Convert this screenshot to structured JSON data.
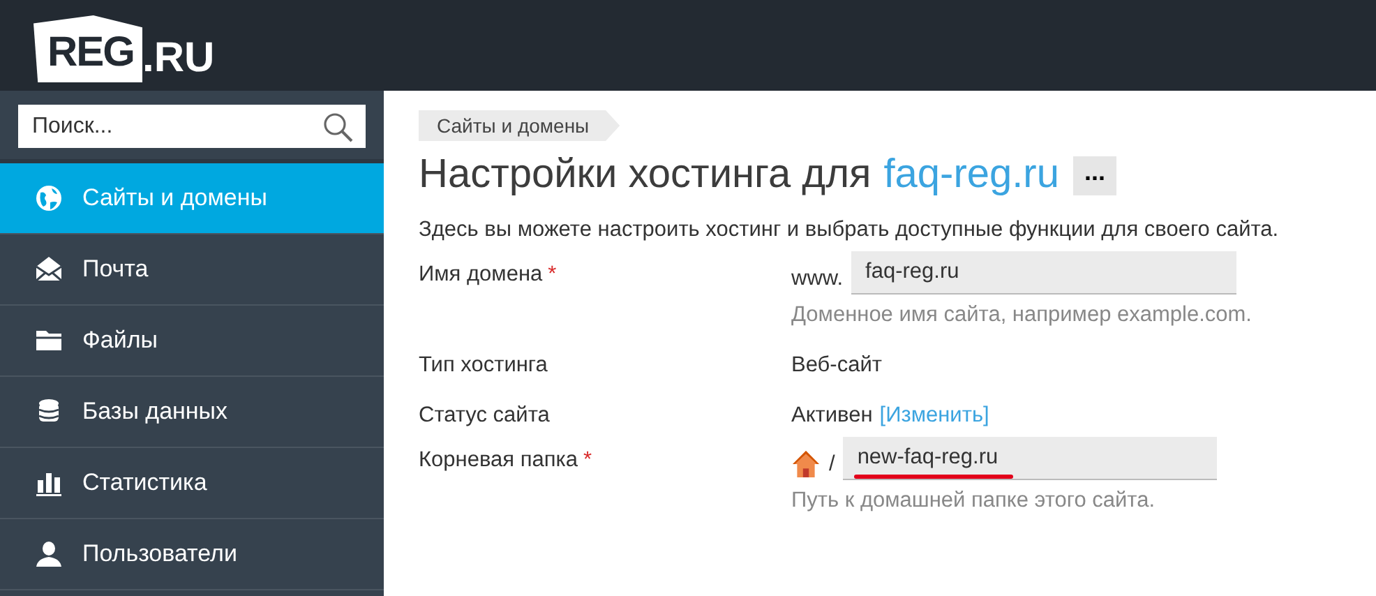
{
  "header": {
    "logo": {
      "mark": "REG",
      "suffix": ".RU"
    }
  },
  "sidebar": {
    "search": {
      "placeholder": "Поиск..."
    },
    "items": [
      {
        "label": "Сайты и домены",
        "selected": true
      },
      {
        "label": "Почта",
        "selected": false
      },
      {
        "label": "Файлы",
        "selected": false
      },
      {
        "label": "Базы данных",
        "selected": false
      },
      {
        "label": "Статистика",
        "selected": false
      },
      {
        "label": "Пользователи",
        "selected": false
      }
    ]
  },
  "breadcrumb": "Сайты и домены",
  "title": {
    "text": "Настройки хостинга для",
    "domain": "faq-reg.ru",
    "more": "..."
  },
  "description": "Здесь вы можете настроить хостинг и выбрать доступные функции для своего сайта.",
  "form": [
    {
      "kind": "input",
      "label": "Имя домена",
      "required_mark": "*",
      "prefix": "www.",
      "value": "faq-reg.ru",
      "hint": "Доменное имя сайта, например example.com."
    },
    {
      "kind": "text",
      "label": "Тип хостинга",
      "value": "Веб-сайт"
    },
    {
      "kind": "status",
      "label": "Статус сайта",
      "value": "Активен",
      "link": "[Изменить]"
    },
    {
      "kind": "folder",
      "label": "Корневая папка",
      "required_mark": "*",
      "prefix": "/",
      "value": "new-faq-reg.ru",
      "hint": "Путь к домашней папке этого сайта."
    }
  ]
}
